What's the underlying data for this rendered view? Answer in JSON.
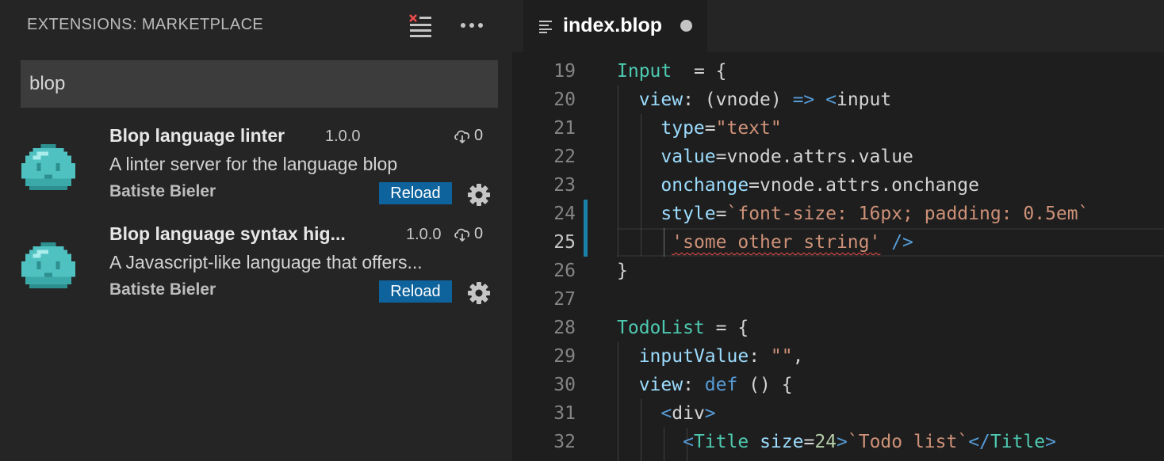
{
  "sidebar": {
    "title": "EXTENSIONS: MARKETPLACE",
    "search_value": "blop",
    "extensions": [
      {
        "name": "Blop language linter",
        "version": "1.0.0",
        "downloads": "0",
        "description": "A linter server for the language blop",
        "author": "Batiste Bieler",
        "action": "Reload"
      },
      {
        "name": "Blop language syntax hig...",
        "version": "1.0.0",
        "downloads": "0",
        "description": "A Javascript-like language that offers...",
        "author": "Batiste Bieler",
        "action": "Reload"
      }
    ]
  },
  "editor": {
    "tab_label": "index.blop",
    "tab_dirty": true,
    "active_line": "25",
    "lines": [
      {
        "n": "19",
        "segs": [
          [
            "t-type",
            "Input"
          ],
          [
            "",
            "  = {"
          ]
        ]
      },
      {
        "n": "20",
        "segs": [
          [
            "",
            "  "
          ],
          [
            "t-attr",
            "view"
          ],
          [
            "",
            ": (vnode) "
          ],
          [
            "t-kw",
            "=>"
          ],
          [
            "t-tag",
            " <"
          ],
          [
            "",
            "input"
          ]
        ]
      },
      {
        "n": "21",
        "segs": [
          [
            "",
            "    "
          ],
          [
            "t-attr",
            "type"
          ],
          [
            "",
            "="
          ],
          [
            "t-str",
            "\"text\""
          ]
        ]
      },
      {
        "n": "22",
        "segs": [
          [
            "",
            "    "
          ],
          [
            "t-attr",
            "value"
          ],
          [
            "",
            "=vnode.attrs.value"
          ]
        ]
      },
      {
        "n": "23",
        "segs": [
          [
            "",
            "    "
          ],
          [
            "t-attr",
            "onchange"
          ],
          [
            "",
            "=vnode.attrs.onchange"
          ]
        ]
      },
      {
        "n": "24",
        "segs": [
          [
            "",
            "    "
          ],
          [
            "t-attr",
            "style"
          ],
          [
            "",
            "="
          ],
          [
            "t-str",
            "`font-size: 16px; padding: 0.5em`"
          ]
        ]
      },
      {
        "n": "25",
        "segs": [
          [
            "",
            "     "
          ],
          [
            "t-str squiggle",
            "'some other string'"
          ],
          [
            "t-tag",
            " />"
          ]
        ]
      },
      {
        "n": "26",
        "segs": [
          [
            "",
            "}"
          ]
        ]
      },
      {
        "n": "27",
        "segs": []
      },
      {
        "n": "28",
        "segs": [
          [
            "t-type",
            "TodoList"
          ],
          [
            "",
            " = {"
          ]
        ]
      },
      {
        "n": "29",
        "segs": [
          [
            "",
            "  "
          ],
          [
            "t-attr",
            "inputValue"
          ],
          [
            "",
            ": "
          ],
          [
            "t-str",
            "\"\""
          ],
          [
            "",
            ","
          ]
        ]
      },
      {
        "n": "30",
        "segs": [
          [
            "",
            "  "
          ],
          [
            "t-attr",
            "view"
          ],
          [
            "",
            ": "
          ],
          [
            "t-kw",
            "def"
          ],
          [
            "",
            " () {"
          ]
        ]
      },
      {
        "n": "31",
        "segs": [
          [
            "",
            "    "
          ],
          [
            "t-tag",
            "<"
          ],
          [
            "",
            "div"
          ],
          [
            "t-tag",
            ">"
          ]
        ]
      },
      {
        "n": "32",
        "segs": [
          [
            "",
            "      "
          ],
          [
            "t-tag",
            "<"
          ],
          [
            "t-type",
            "Title"
          ],
          [
            "",
            " "
          ],
          [
            "t-attr",
            "size"
          ],
          [
            "",
            "="
          ],
          [
            "t-num",
            "24"
          ],
          [
            "t-tag",
            ">"
          ],
          [
            "t-str",
            "`Todo list`"
          ],
          [
            "t-tag",
            "</"
          ],
          [
            "t-type",
            "Title"
          ],
          [
            "t-tag",
            ">"
          ]
        ]
      }
    ]
  },
  "colors": {
    "reload_button": "#0e639c",
    "modified_gutter": "#1b81a8",
    "error_squiggle": "#f14c4c",
    "extension_icon": "#4fc1c0"
  },
  "icons": {
    "clear": "clear-extensions-icon",
    "more": "more-actions-icon",
    "download": "cloud-download-icon",
    "manage": "gear-icon",
    "file": "file-lines-icon"
  }
}
